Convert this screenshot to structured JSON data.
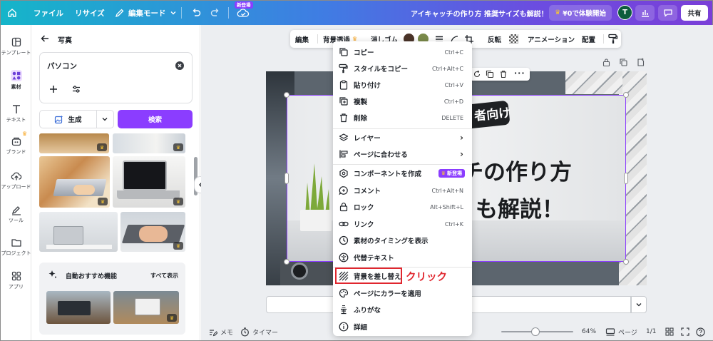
{
  "topbar": {
    "file": "ファイル",
    "resize": "リサイズ",
    "edit_mode": "編集モード",
    "new_badge": "新登場",
    "doc_title": "アイキャッチの作り方 推奨サイズも解説！",
    "trial": "¥0で体験開始",
    "avatar": "T",
    "share": "共有"
  },
  "rail": [
    {
      "label": "テンプレート",
      "icon": "template-icon"
    },
    {
      "label": "素材",
      "icon": "elements-icon"
    },
    {
      "label": "テキスト",
      "icon": "text-icon"
    },
    {
      "label": "ブランド",
      "icon": "brand-icon"
    },
    {
      "label": "アップロード",
      "icon": "upload-icon"
    },
    {
      "label": "ツール",
      "icon": "draw-icon"
    },
    {
      "label": "プロジェクト",
      "icon": "folder-icon"
    },
    {
      "label": "アプリ",
      "icon": "apps-icon"
    }
  ],
  "panel": {
    "header": "写真",
    "search_value": "パソコン",
    "generate": "生成",
    "search_button": "検索",
    "recommend_title": "自動おすすめ機能",
    "show_all": "すべて表示"
  },
  "toolbar": {
    "edit": "編集",
    "bg_remove": "背景透過",
    "erase": "消しゴム",
    "flip": "反転",
    "animation": "アニメーション",
    "arrange": "配置"
  },
  "context_menu": [
    {
      "label": "コピー",
      "shortcut": "Ctrl+C",
      "icon": "copy-icon"
    },
    {
      "label": "スタイルをコピー",
      "shortcut": "Ctrl+Alt+C",
      "icon": "paint-roller-icon"
    },
    {
      "label": "貼り付け",
      "shortcut": "Ctrl+V",
      "icon": "clipboard-icon"
    },
    {
      "label": "複製",
      "shortcut": "Ctrl+D",
      "icon": "duplicate-icon"
    },
    {
      "label": "削除",
      "shortcut": "DELETE",
      "icon": "trash-icon"
    },
    {
      "label": "レイヤー",
      "icon": "layers-icon"
    },
    {
      "label": "ページに合わせる",
      "icon": "align-page-icon"
    },
    {
      "label": "コンポーネントを作成",
      "badge": "新登場",
      "icon": "component-icon"
    },
    {
      "label": "コメント",
      "shortcut": "Ctrl+Alt+N",
      "icon": "comment-icon"
    },
    {
      "label": "ロック",
      "shortcut": "Alt+Shift+L",
      "icon": "lock-icon"
    },
    {
      "label": "リンク",
      "shortcut": "Ctrl+K",
      "icon": "link-icon"
    },
    {
      "label": "素材のタイミングを表示",
      "icon": "clock-icon"
    },
    {
      "label": "代替テキスト",
      "icon": "accessibility-icon"
    },
    {
      "label": "背景を差し替え",
      "icon": "replace-bg-icon"
    },
    {
      "label": "ページにカラーを適用",
      "icon": "palette-icon"
    },
    {
      "label": "ふりがな",
      "icon": "furigana-icon"
    },
    {
      "label": "詳細",
      "icon": "info-icon"
    }
  ],
  "annotation": "クリック",
  "canvas_text": {
    "tag": "者向け",
    "line1": "チの作り方",
    "line2": "も解説！"
  },
  "bottombar": {
    "memo": "メモ",
    "timer": "タイマー",
    "zoom": "64%",
    "page": "ページ",
    "page_count": "1/1"
  },
  "colors": {
    "accent": "#8b3dff",
    "annotation_red": "#e0262e",
    "swatch_brown": "#4a3328",
    "swatch_olive": "#7a8a4a"
  }
}
